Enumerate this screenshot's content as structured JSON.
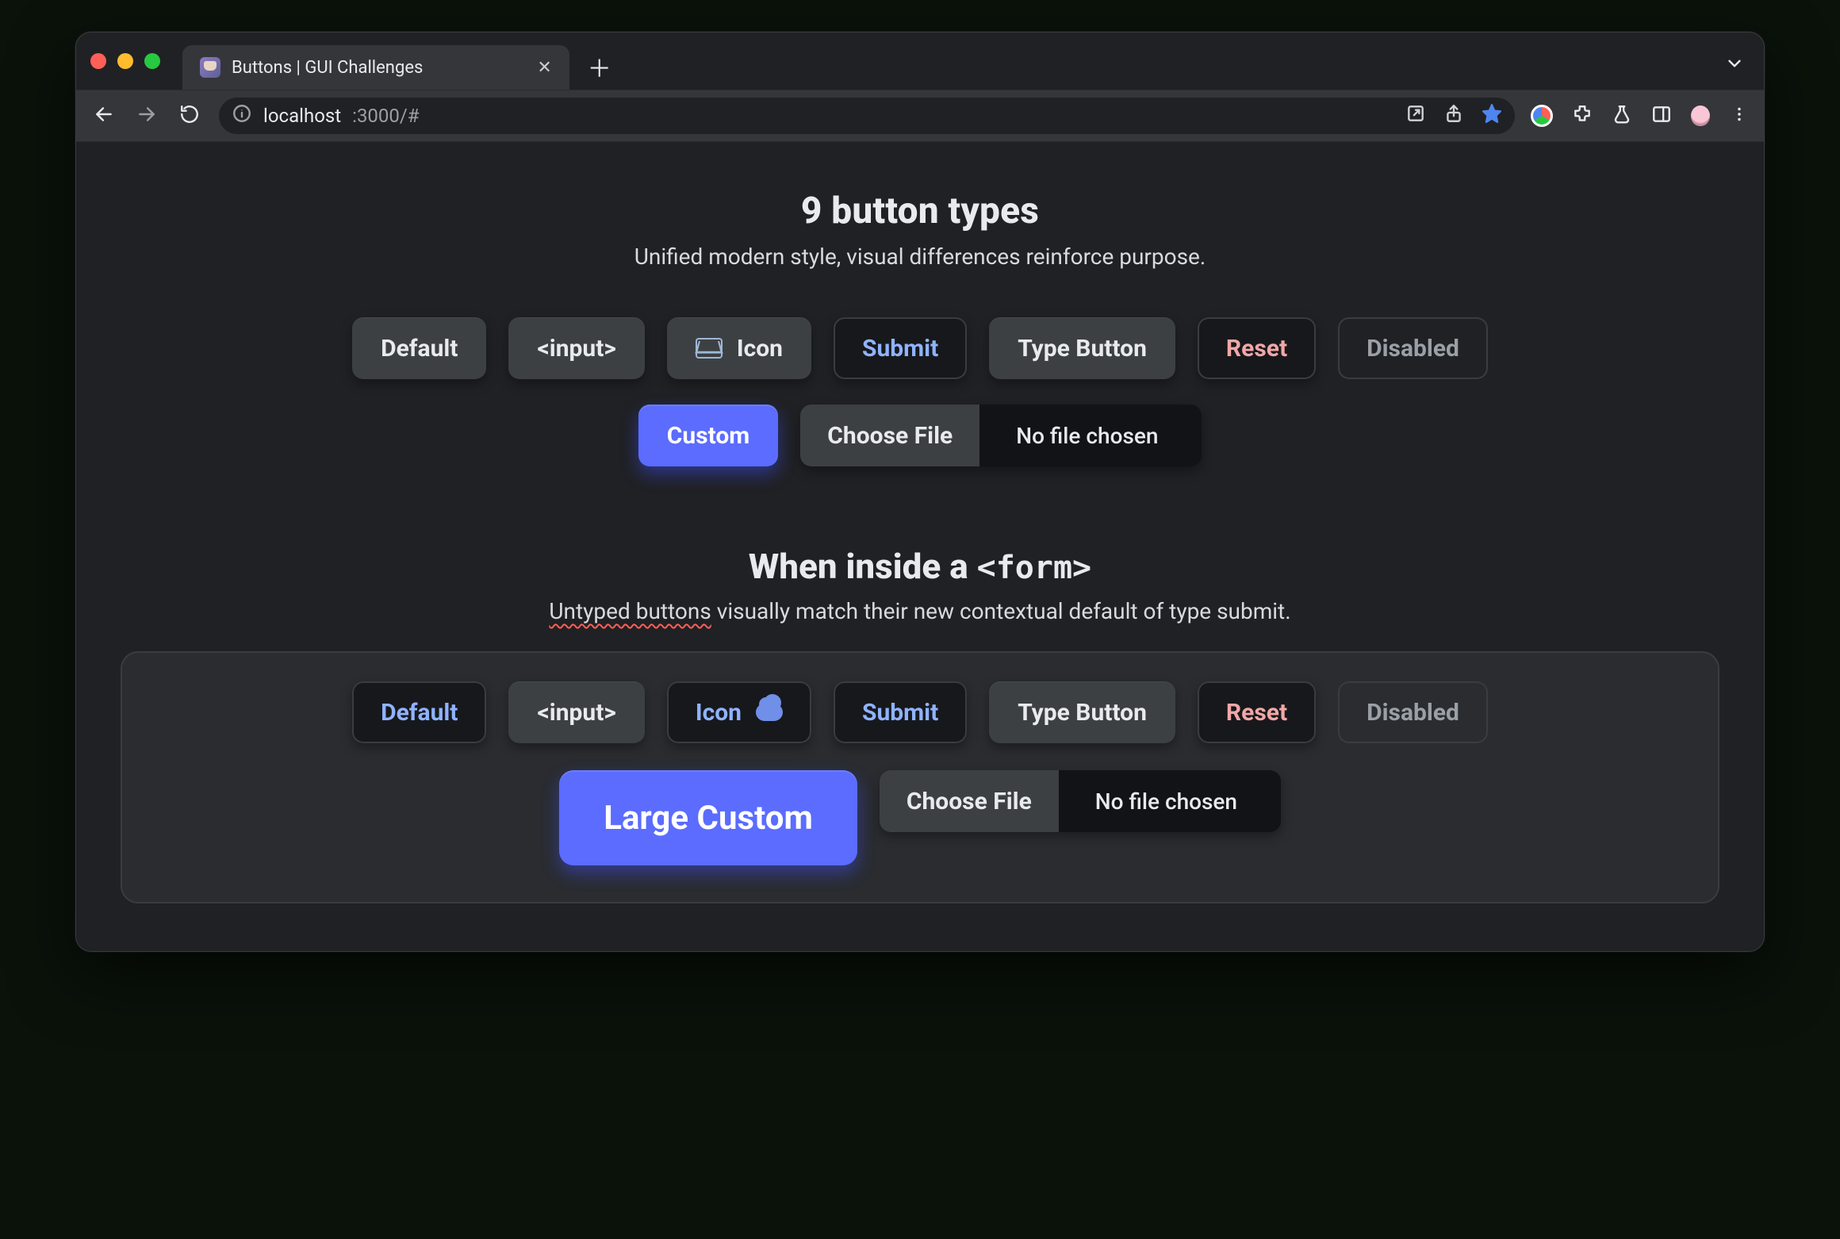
{
  "browser": {
    "tab_title": "Buttons | GUI Challenges",
    "url_host": "localhost",
    "url_port_path": ":3000/#"
  },
  "section1": {
    "title": "9 button types",
    "subtitle": "Unified modern style, visual differences reinforce purpose.",
    "buttons": {
      "default": "Default",
      "input": "<input>",
      "icon": "Icon",
      "submit": "Submit",
      "type_button": "Type Button",
      "reset": "Reset",
      "disabled": "Disabled",
      "custom": "Custom"
    },
    "file": {
      "choose": "Choose File",
      "nofile": "No file chosen"
    }
  },
  "section2": {
    "title_prefix": "When inside a ",
    "title_code": "<form>",
    "subtitle_emph": "Untyped buttons",
    "subtitle_rest": " visually match their new contextual default of type submit.",
    "buttons": {
      "default": "Default",
      "input": "<input>",
      "icon": "Icon",
      "submit": "Submit",
      "type_button": "Type Button",
      "reset": "Reset",
      "disabled": "Disabled",
      "large_custom": "Large Custom"
    },
    "file": {
      "choose": "Choose File",
      "nofile": "No file chosen"
    }
  }
}
